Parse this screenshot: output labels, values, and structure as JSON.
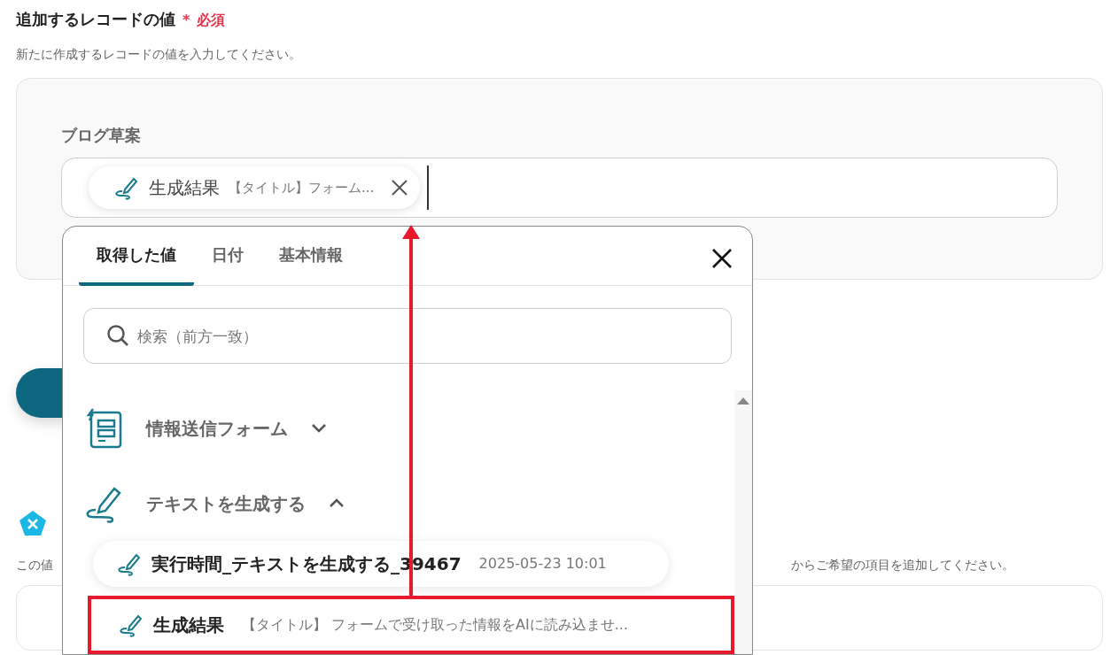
{
  "header": {
    "title": "追加するレコードの値",
    "required_mark": "*",
    "required_label": "必須",
    "description": "新たに作成するレコードの値を入力してください。"
  },
  "record_panel": {
    "field_label": "ブログ草案",
    "chip": {
      "title": "生成結果",
      "detail": "【タイトル】フォーム..."
    }
  },
  "lower_section": {
    "description_start": "この値",
    "description_end": "からご希望の項目を追加してください。"
  },
  "picker": {
    "tabs": [
      {
        "label": "取得した値",
        "selected": true
      },
      {
        "label": "日付",
        "selected": false
      },
      {
        "label": "基本情報",
        "selected": false
      }
    ],
    "search": {
      "placeholder": "検索（前方一致）"
    },
    "groups": [
      {
        "title": "情報送信フォーム",
        "kind": "form",
        "expanded": false
      },
      {
        "title": "テキストを生成する",
        "kind": "text",
        "expanded": true,
        "items": [
          {
            "title": "実行時間_テキストを生成する_39467",
            "detail": "2025-05-23 10:01",
            "highlighted": false
          },
          {
            "title": "生成結果",
            "detail": "【タイトル】 フォームで受け取った情報をAIに読み込ませ...",
            "highlighted": true
          }
        ]
      }
    ]
  },
  "annotation_arrow": true
}
